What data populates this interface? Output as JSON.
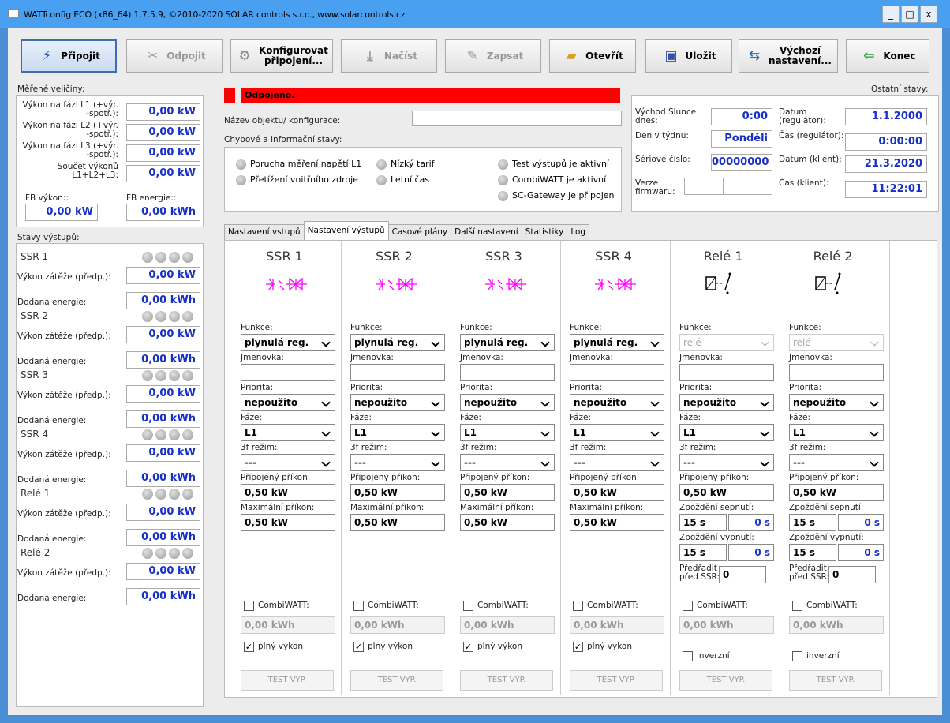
{
  "window": {
    "title": "WATTconfig ECO (x86_64) 1.7.5.9, ©2010-2020 SOLAR controls s.r.o., www.solarcontrols.cz",
    "min": "_",
    "max": "□",
    "close": "x"
  },
  "toolbar": {
    "connect": "Připojit",
    "disconnect": "Odpojit",
    "configure1": "Konfigurovat",
    "configure2": "připojení...",
    "load": "Načíst",
    "write": "Zapsat",
    "open": "Otevřít",
    "save": "Uložit",
    "defaults1": "Výchozí",
    "defaults2": "nastavení...",
    "exit": "Konec"
  },
  "measured": {
    "title": "Měřené veličiny:",
    "rows": [
      {
        "l1": "Výkon na fázi L1 (+výr.",
        "l2": "-spotř.):",
        "v": "0,00 kW"
      },
      {
        "l1": "Výkon na fázi L2 (+výr.",
        "l2": "-spotř.):",
        "v": "0,00 kW"
      },
      {
        "l1": "Výkon na fázi L3 (+výr.",
        "l2": "-spotř.):",
        "v": "0,00 kW"
      },
      {
        "l1": "Součet výkonů",
        "l2": "L1+L2+L3:",
        "v": "0,00 kW"
      }
    ],
    "fb_power_label": "FB výkon::",
    "fb_power": "0,00 kW",
    "fb_energy_label": "FB energie::",
    "fb_energy": "0,00 kWh"
  },
  "outputs_state": {
    "title": "Stavy výstupů:",
    "power_label": "Výkon zátěže (předp.):",
    "energy_label": "Dodaná energie:",
    "items": [
      {
        "name": "SSR 1",
        "p": "0,00 kW",
        "e": "0,00 kWh"
      },
      {
        "name": "SSR 2",
        "p": "0,00 kW",
        "e": "0,00 kWh"
      },
      {
        "name": "SSR 3",
        "p": "0,00 kW",
        "e": "0,00 kWh"
      },
      {
        "name": "SSR 4",
        "p": "0,00 kW",
        "e": "0,00 kWh"
      },
      {
        "name": "Relé 1",
        "p": "0,00 kW",
        "e": "0,00 kWh"
      },
      {
        "name": "Relé 2",
        "p": "0,00 kW",
        "e": "0,00 kWh"
      }
    ]
  },
  "status": {
    "text": "Odpojeno.",
    "color": "#ff0000",
    "name_label": "Název objektu/ konfigurace:",
    "name_value": "",
    "errors_label": "Chybové a informační stavy:",
    "flags": [
      "Porucha měření napětí L1",
      "Přetížení vnitřního zdroje",
      "Nízký tarif",
      "Letní čas",
      "Test výstupů je aktivní",
      "CombiWATT je aktivní",
      "SC-Gateway je připojen"
    ]
  },
  "other": {
    "title": "Ostatní stavy:",
    "sunrise_label1": "Východ Slunce",
    "sunrise_label2": "dnes:",
    "sunrise": "0:00",
    "date_reg_label1": "Datum",
    "date_reg_label2": "(regulátor):",
    "date_reg": "1.1.2000",
    "weekday_label": "Den v týdnu:",
    "weekday": "Ponděli",
    "time_reg_label": "Čas (regulátor):",
    "time_reg": "0:00:00",
    "serial_label": "Sériové číslo:",
    "serial": "00000000",
    "date_cli_label": "Datum (klient):",
    "date_cli": "21.3.2020",
    "fw_label1": "Verze",
    "fw_label2": "firmwaru:",
    "time_cli_label": "Čas (klient):",
    "time_cli": "11:22:01"
  },
  "tabs": [
    "Nastavení vstupů",
    "Nastavení výstupů",
    "Časové plány",
    "Další nastavení",
    "Statistiky",
    "Log"
  ],
  "labels": {
    "func": "Funkce:",
    "tag": "Jmenovka:",
    "prio": "Priorita:",
    "phase": "Fáze:",
    "mode3": "3f režim:",
    "conn": "Připojený příkon:",
    "max": "Maximální příkon:",
    "delay_on": "Zpoždění sepnutí:",
    "delay_off": "Zpoždění vypnutí:",
    "pre1": "Předřadit",
    "pre2": "před SSR:",
    "combi": "CombiWATT:",
    "full": "plný výkon",
    "inv": "inverzní",
    "test": "TEST VYP."
  },
  "columns": [
    {
      "name": "SSR 1",
      "func": "plynulá reg.",
      "prio": "nepoužito",
      "phase": "L1",
      "mode": "---",
      "conn": "0,50 kW",
      "max": "0,50 kW",
      "kwh": "0,00 kWh"
    },
    {
      "name": "SSR 2",
      "func": "plynulá reg.",
      "prio": "nepoužito",
      "phase": "L1",
      "mode": "---",
      "conn": "0,50 kW",
      "max": "0,50 kW",
      "kwh": "0,00 kWh"
    },
    {
      "name": "SSR 3",
      "func": "plynulá reg.",
      "prio": "nepoužito",
      "phase": "L1",
      "mode": "---",
      "conn": "0,50 kW",
      "max": "0,50 kW",
      "kwh": "0,00 kWh"
    },
    {
      "name": "SSR 4",
      "func": "plynulá reg.",
      "prio": "nepoužito",
      "phase": "L1",
      "mode": "---",
      "conn": "0,50 kW",
      "max": "0,50 kW",
      "kwh": "0,00 kWh"
    },
    {
      "name": "Relé 1",
      "func": "relé",
      "prio": "nepoužito",
      "phase": "L1",
      "mode": "---",
      "conn": "0,50 kW",
      "d_on": "15 s",
      "d_on2": "0 s",
      "d_off": "15 s",
      "d_off2": "0 s",
      "pre": "0",
      "kwh": "0,00 kWh"
    },
    {
      "name": "Relé 2",
      "func": "relé",
      "prio": "nepoužito",
      "phase": "L1",
      "mode": "---",
      "conn": "0,50 kW",
      "d_on": "15 s",
      "d_on2": "0 s",
      "d_off": "15 s",
      "d_off2": "0 s",
      "pre": "0",
      "kwh": "0,00 kWh"
    }
  ],
  "colors": {
    "value_text": "#1730c8",
    "ssr_symbol": "#ff00ff",
    "title_bar": "#4aa0f0"
  }
}
